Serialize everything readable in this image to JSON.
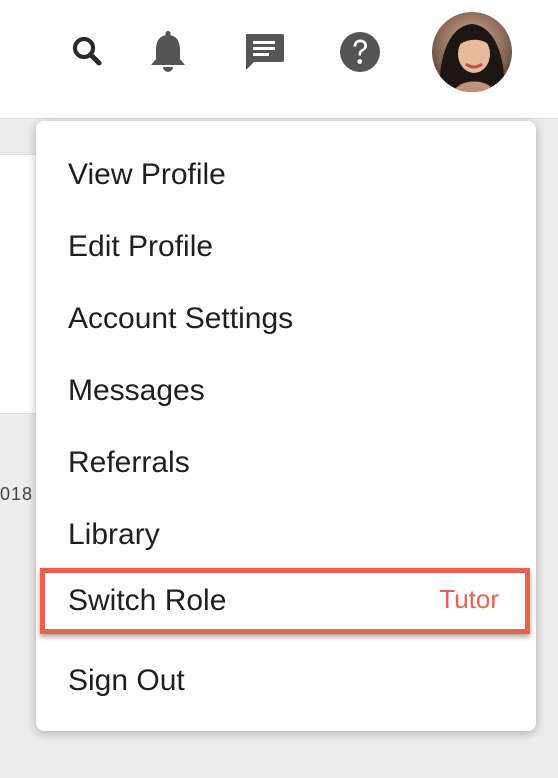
{
  "header": {
    "icons": [
      "search-icon",
      "bell-icon",
      "chat-icon",
      "help-icon"
    ],
    "icon_color": "#2b2b2b",
    "avatar": "user-avatar-photo"
  },
  "background": {
    "partial_text": "018"
  },
  "menu": {
    "items": [
      {
        "label": "View Profile"
      },
      {
        "label": "Edit Profile"
      },
      {
        "label": "Account Settings"
      },
      {
        "label": "Messages"
      },
      {
        "label": "Referrals"
      },
      {
        "label": "Library"
      }
    ],
    "switch_role": {
      "label": "Switch Role",
      "value": "Tutor",
      "highlight_color": "#e8634f"
    },
    "sign_out": {
      "label": "Sign Out"
    }
  }
}
